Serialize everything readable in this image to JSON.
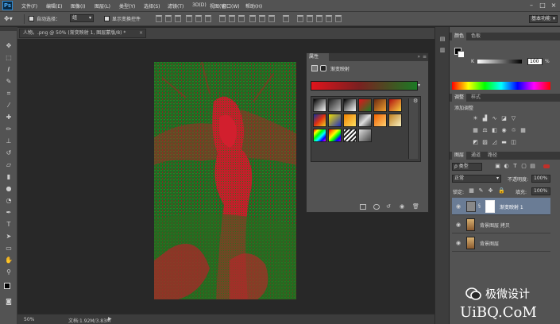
{
  "app": {
    "logo_text": "Ps"
  },
  "menu": [
    "文件(F)",
    "编辑(E)",
    "图像(I)",
    "图层(L)",
    "类型(Y)",
    "选择(S)",
    "滤镜(T)",
    "3D(D)",
    "视图(V)",
    "窗口(W)",
    "帮助(H)"
  ],
  "options": {
    "auto_select_label": "自动选择：",
    "auto_select_value": "组",
    "show_transform_label": "显示变换控件",
    "workspace": "基本功能"
  },
  "document": {
    "tab_title": "人物。.png @ 50% (渐变映射 1, 图层蒙版/8) *",
    "zoom": "50%",
    "doc_info": "文档:1.92M/3.83M"
  },
  "properties": {
    "tab": "属性",
    "title": "渐变映射"
  },
  "color_panel": {
    "tabs": [
      "颜色",
      "色板"
    ],
    "channel": "K",
    "value": "100",
    "unit": "%"
  },
  "adjustments": {
    "tabs": [
      "调整",
      "样式"
    ],
    "title": "添加调整"
  },
  "layers_panel": {
    "tabs": [
      "图层",
      "通道",
      "路径"
    ],
    "filter_kind": "ρ 类型",
    "blend_mode": "正常",
    "opacity_label": "不透明度:",
    "opacity_value": "100%",
    "lock_label": "锁定:",
    "fill_label": "填充:",
    "fill_value": "100%",
    "layers": [
      {
        "name": "渐变映射 1",
        "selected": true
      },
      {
        "name": "背景图层 拷贝",
        "selected": false
      },
      {
        "name": "背景图层",
        "selected": false
      }
    ]
  },
  "watermark": {
    "brand": "极微设计",
    "site": "UiBQ.CoM"
  }
}
